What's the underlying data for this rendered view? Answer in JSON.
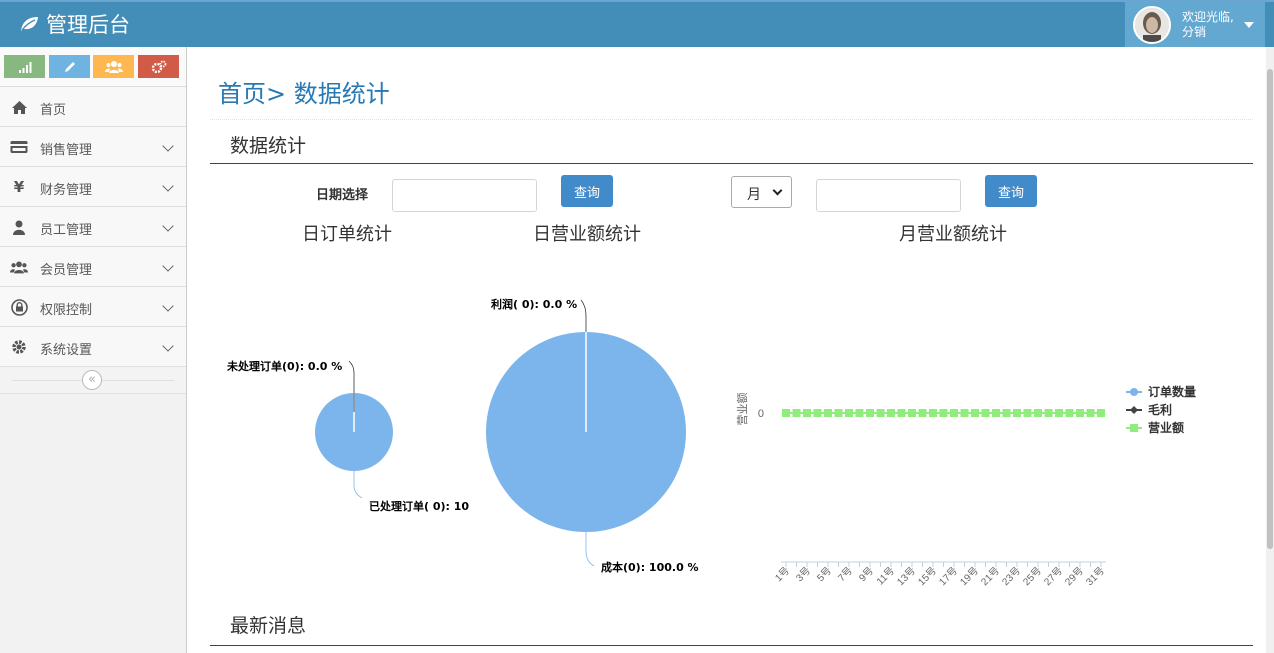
{
  "app": {
    "title": "管理后台",
    "brand_color": "#438eb9"
  },
  "user": {
    "greeting": "欢迎光临,",
    "name": "分销"
  },
  "sidebar": {
    "shortcuts": [
      {
        "icon": "signal-icon",
        "color": "#87b87f"
      },
      {
        "icon": "pencil-icon",
        "color": "#6fb3e0"
      },
      {
        "icon": "users-icon",
        "color": "#ffb752"
      },
      {
        "icon": "cogs-icon",
        "color": "#d15b47"
      }
    ],
    "items": [
      {
        "label": "首页",
        "icon": "home-icon"
      },
      {
        "label": "销售管理",
        "icon": "credit-card-icon"
      },
      {
        "label": "财务管理",
        "icon": "yen-icon"
      },
      {
        "label": "员工管理",
        "icon": "user-icon"
      },
      {
        "label": "会员管理",
        "icon": "group-icon"
      },
      {
        "label": "权限控制",
        "icon": "lock-icon"
      },
      {
        "label": "系统设置",
        "icon": "cog-icon"
      }
    ]
  },
  "breadcrumb": {
    "title": "首页> 数据统计"
  },
  "stats": {
    "section_title": "数据统计",
    "date_label": "日期选择",
    "date_value": "",
    "query_label": "查询",
    "month_select": "月",
    "month_value": "",
    "query2_label": "查询"
  },
  "charts": {
    "daily_orders_title": "日订单统计",
    "daily_revenue_title": "日营业额统计",
    "monthly_revenue_title": "月营业额统计"
  },
  "news": {
    "section_title": "最新消息"
  },
  "chart_data": [
    {
      "type": "pie",
      "title": "日订单统计",
      "slices": [
        {
          "label": "未处理订单(0): 0.0 %",
          "value": 0
        },
        {
          "label": "已处理订单( 0): 10",
          "value": 100
        }
      ],
      "color": "#7cb5ec"
    },
    {
      "type": "pie",
      "title": "日营业额统计",
      "slices": [
        {
          "label": "利润( 0): 0.0 %",
          "value": 0
        },
        {
          "label": "成本(0): 100.0 %",
          "value": 100
        }
      ],
      "color": "#7cb5ec"
    },
    {
      "type": "line",
      "title": "月营业额统计",
      "ylabel": "营业额",
      "yticks": [
        0
      ],
      "categories": [
        "1号",
        "3号",
        "5号",
        "7号",
        "9号",
        "11号",
        "13号",
        "15号",
        "17号",
        "19号",
        "21号",
        "23号",
        "25号",
        "27号",
        "29号",
        "31号"
      ],
      "x": [
        1,
        2,
        3,
        4,
        5,
        6,
        7,
        8,
        9,
        10,
        11,
        12,
        13,
        14,
        15,
        16,
        17,
        18,
        19,
        20,
        21,
        22,
        23,
        24,
        25,
        26,
        27,
        28,
        29,
        30,
        31
      ],
      "series": [
        {
          "name": "订单数量",
          "color": "#7cb5ec",
          "marker": "circle",
          "values": [
            0,
            0,
            0,
            0,
            0,
            0,
            0,
            0,
            0,
            0,
            0,
            0,
            0,
            0,
            0,
            0,
            0,
            0,
            0,
            0,
            0,
            0,
            0,
            0,
            0,
            0,
            0,
            0,
            0,
            0,
            0
          ]
        },
        {
          "name": "毛利",
          "color": "#434348",
          "marker": "diamond",
          "values": [
            0,
            0,
            0,
            0,
            0,
            0,
            0,
            0,
            0,
            0,
            0,
            0,
            0,
            0,
            0,
            0,
            0,
            0,
            0,
            0,
            0,
            0,
            0,
            0,
            0,
            0,
            0,
            0,
            0,
            0,
            0
          ]
        },
        {
          "name": "营业额",
          "color": "#90ed7d",
          "marker": "square",
          "values": [
            0,
            0,
            0,
            0,
            0,
            0,
            0,
            0,
            0,
            0,
            0,
            0,
            0,
            0,
            0,
            0,
            0,
            0,
            0,
            0,
            0,
            0,
            0,
            0,
            0,
            0,
            0,
            0,
            0,
            0,
            0
          ]
        }
      ],
      "legend": "right"
    }
  ]
}
